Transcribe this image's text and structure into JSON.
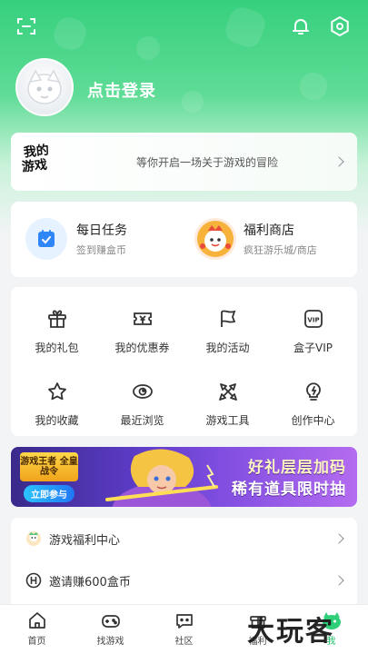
{
  "header": {
    "scan_icon": "scan-icon",
    "bell_icon": "bell-icon",
    "settings_icon": "settings-hexagon-icon",
    "login_label": "点击登录"
  },
  "banner": {
    "logo_line1": "我的",
    "logo_line2": "游戏",
    "tagline": "等你开启一场关于游戏的冒险"
  },
  "tasks": {
    "daily_title": "每日任务",
    "daily_sub": "签到赚盒币",
    "shop_title": "福利商店",
    "shop_sub": "疯狂游乐城/商店"
  },
  "grid": [
    {
      "label": "我的礼包",
      "icon": "gift-icon"
    },
    {
      "label": "我的优惠券",
      "icon": "coupon-icon"
    },
    {
      "label": "我的活动",
      "icon": "flag-icon"
    },
    {
      "label": "盒子VIP",
      "icon": "vip-icon"
    },
    {
      "label": "我的收藏",
      "icon": "star-icon"
    },
    {
      "label": "最近浏览",
      "icon": "eye-icon"
    },
    {
      "label": "游戏工具",
      "icon": "tools-icon"
    },
    {
      "label": "创作中心",
      "icon": "lightbulb-icon"
    }
  ],
  "promo": {
    "badge": "游戏王者 全皇战令",
    "join_label": "立即参与",
    "line1": "好礼层层加码",
    "line2": "稀有道具限时抽"
  },
  "list": [
    {
      "label": "游戏福利中心",
      "icon": "game-welfare-icon"
    },
    {
      "label": "邀请赚600盒币",
      "icon": "coin-h-icon"
    }
  ],
  "tabs": [
    {
      "label": "首页",
      "icon": "home-icon"
    },
    {
      "label": "找游戏",
      "icon": "gamepad-icon"
    },
    {
      "label": "社区",
      "icon": "chat-icon"
    },
    {
      "label": "福利",
      "icon": "gift-tab-icon"
    },
    {
      "label": "我",
      "icon": "me-icon"
    }
  ],
  "watermark": "大玩客",
  "colors": {
    "brand_green": "#2fcf7a",
    "active_tab": "#1fbf66"
  }
}
